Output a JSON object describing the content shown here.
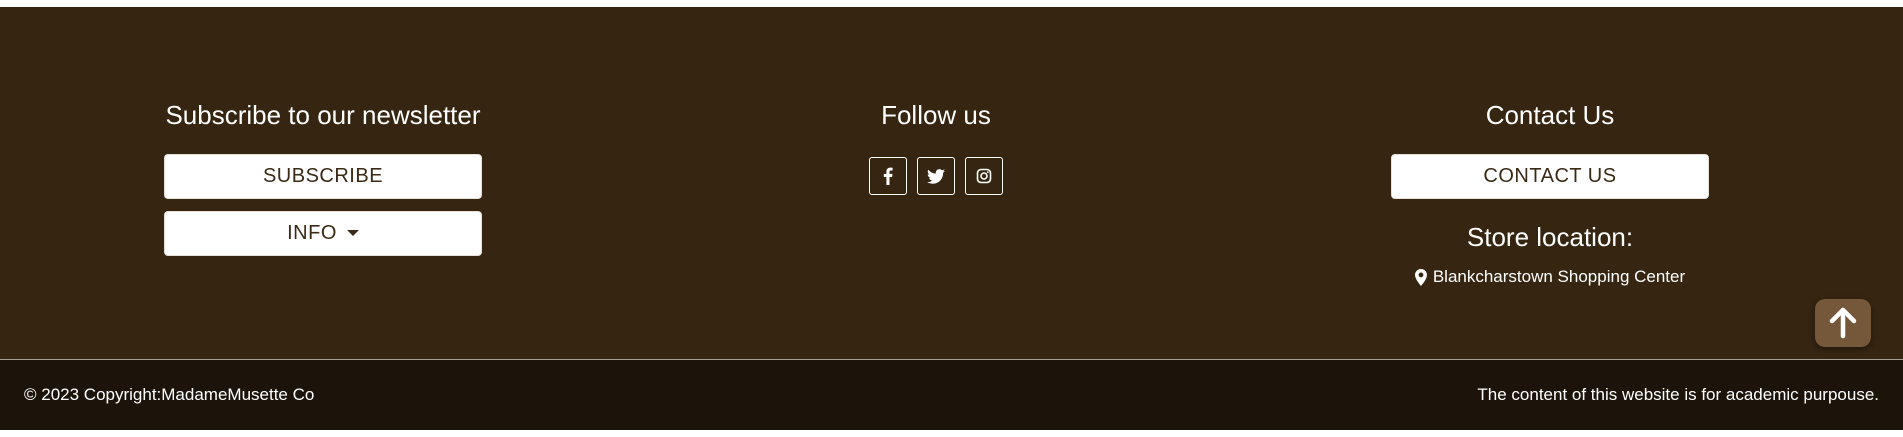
{
  "colors": {
    "footer_background": "#352511",
    "bottom_bar_background": "#1c140b",
    "back_to_top_background": "#75573a",
    "button_text": "#3b2a16"
  },
  "newsletter": {
    "title": "Subscribe to our newsletter",
    "subscribe_label": "SUBSCRIBE",
    "info_label": "INFO"
  },
  "follow": {
    "title": "Follow us",
    "icons": [
      "facebook-icon",
      "twitter-icon",
      "instagram-icon"
    ]
  },
  "contact": {
    "title": "Contact Us",
    "button_label": "CONTACT US",
    "store_title": "Store location:",
    "store_address": "Blankcharstown Shopping Center",
    "store_icon": "map-marker-icon"
  },
  "back_to_top": {
    "icon": "arrow-up-icon"
  },
  "bottom_bar": {
    "copyright": "© 2023 Copyright:MadameMusette Co",
    "disclaimer": "The content of this website is for academic purpouse."
  }
}
